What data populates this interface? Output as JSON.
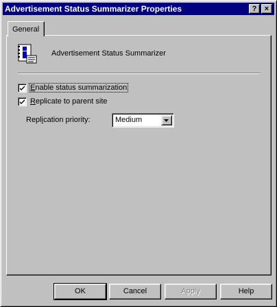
{
  "window": {
    "title": "Advertisement Status Summarizer Properties",
    "help_button": "?",
    "close_button": "×"
  },
  "tabs": [
    {
      "label": "General",
      "selected": true
    }
  ],
  "general": {
    "component_name": "Advertisement Status Summarizer",
    "enable_summarization": {
      "label_underlined": "E",
      "label_rest": "nable status summarization",
      "checked": true
    },
    "replicate_parent": {
      "label_underlined": "R",
      "label_rest": "eplicate to parent site",
      "checked": true
    },
    "replication_priority": {
      "label_before": "Repl",
      "label_underlined": "i",
      "label_after": "cation priority:",
      "value": "Medium"
    }
  },
  "buttons": {
    "ok": "OK",
    "cancel": "Cancel",
    "apply": "Apply",
    "help": "Help"
  }
}
